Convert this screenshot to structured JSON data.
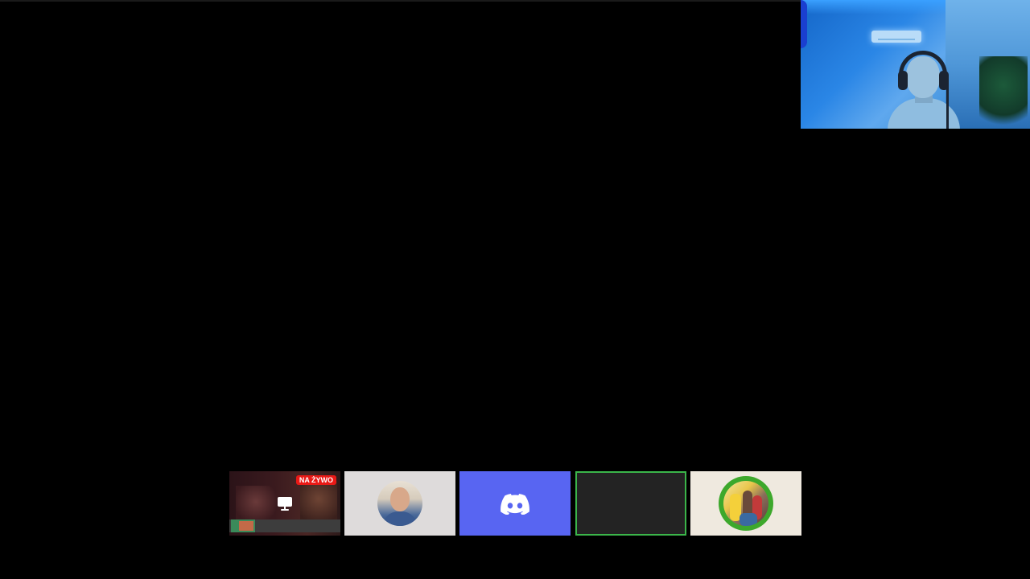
{
  "stream_tile": {
    "live_badge": "NA ŻYWO",
    "icon": "screen-share-icon"
  },
  "avatar_tile": {
    "icon": "user-avatar"
  },
  "discord_tile": {
    "icon": "discord-icon",
    "color": "#5865f2"
  },
  "empty_tile": {
    "border_color": "#3bb54a"
  },
  "group_tile": {
    "icon": "group-avatar",
    "ring_color": "#3da82c"
  },
  "colors": {
    "background": "#000000",
    "live_badge": "#e91916"
  }
}
